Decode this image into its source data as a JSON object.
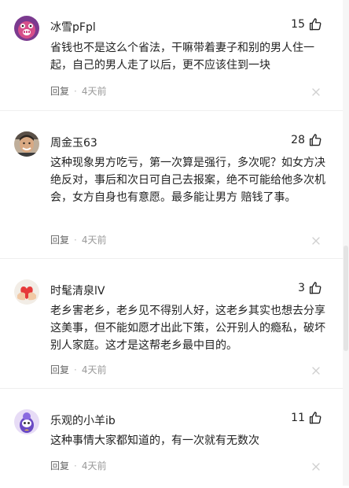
{
  "comments": [
    {
      "username": "冰雪pFpl",
      "likes": "15",
      "content": "省钱也不是这么个省法，干嘛带着妻子和别的男人住一起，自己的男人走了以后，更不应该住到一块",
      "reply": "回复",
      "time": "4天前",
      "avatar": "pink-monster-avatar"
    },
    {
      "username": "周金玉63",
      "likes": "28",
      "content": "这种现象男方吃亏，第一次算是强行，多次呢？如女方决绝反对，事后和次日可自己去报案，绝不可能给他多次机会，女方自身也有意愿。最多能让男方 赔钱了事。",
      "reply": "回复",
      "time": "4天前",
      "avatar": "man-photo-avatar"
    },
    {
      "username": "时髦清泉lV",
      "likes": "3",
      "content": "老乡害老乡，老乡见不得别人好，这老乡其实也想去分享这美事，但不能如愿才出此下策，公开别人的瘾私，破坏别人家庭。这才是这帮老乡最中目的。",
      "reply": "回复",
      "time": "4天前",
      "avatar": "hand-heart-avatar"
    },
    {
      "username": "乐观的小羊ib",
      "likes": "11",
      "content": "这种事情大家都知道的，有一次就有无数次",
      "reply": "回复",
      "time": "4天前",
      "avatar": "purple-creature-avatar"
    }
  ],
  "icons": {
    "like": "thumbs-up-icon",
    "close": "close-icon"
  }
}
